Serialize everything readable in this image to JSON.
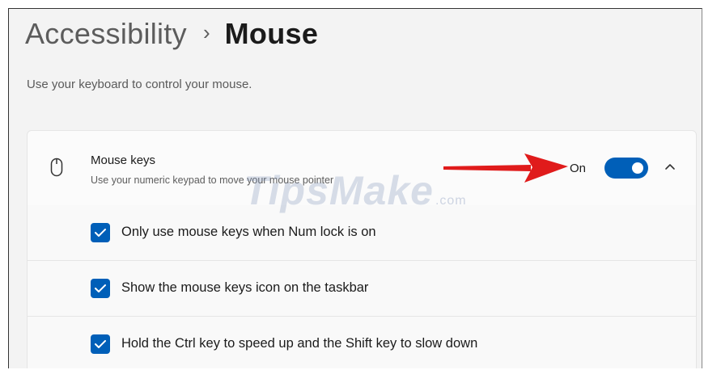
{
  "header": {
    "breadcrumb_parent": "Accessibility",
    "breadcrumb_separator": "›",
    "breadcrumb_current": "Mouse",
    "subtitle": "Use your keyboard to control your mouse."
  },
  "mouse_keys": {
    "icon": "mouse-icon",
    "title": "Mouse keys",
    "description": "Use your numeric keypad to move your mouse pointer",
    "state_label": "On",
    "toggle_on": true,
    "expanded": true
  },
  "options": [
    {
      "label": "Only use mouse keys when Num lock is on",
      "checked": true
    },
    {
      "label": "Show the mouse keys icon on the taskbar",
      "checked": true
    },
    {
      "label": "Hold the Ctrl key to speed up and the Shift key to slow down",
      "checked": true
    }
  ],
  "annotation": {
    "type": "red-arrow",
    "color": "#e01b1b"
  },
  "watermark": {
    "text": "TipsMake",
    "suffix": ".com"
  },
  "colors": {
    "accent": "#005fb8",
    "background": "#f3f3f3",
    "card": "#fbfbfb"
  }
}
